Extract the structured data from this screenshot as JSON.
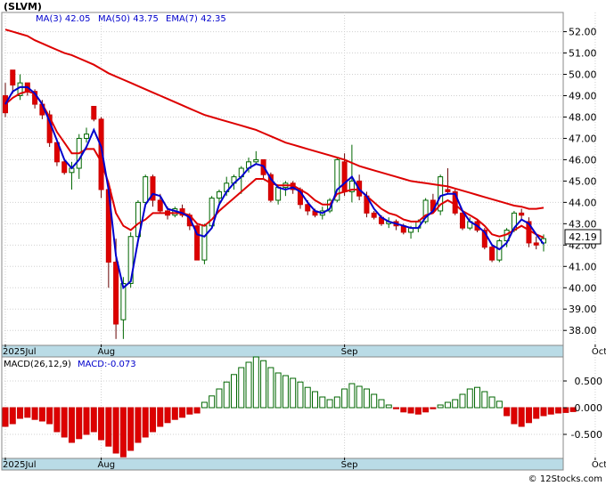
{
  "chart_data": {
    "type": "candlestick",
    "ticker_label": "(SLVM)",
    "legend": [
      {
        "label": "MA(3)",
        "value": "42.05",
        "color": "#0000cc"
      },
      {
        "label": "MA(50)",
        "value": "43.75",
        "color": "#0000cc"
      },
      {
        "label": "EMA(7)",
        "value": "42.35",
        "color": "#0000cc"
      }
    ],
    "last_price_label": "42.19",
    "x_axis_labels": [
      {
        "text": "2025Jul",
        "index": 0
      },
      {
        "text": "Aug",
        "index": 13
      },
      {
        "text": "Sep",
        "index": 46
      },
      {
        "text": "Oct",
        "index": 80
      }
    ],
    "price_axis": {
      "ylim": [
        37.3,
        52.9
      ],
      "ticks": [
        "38.00",
        "39.00",
        "40.00",
        "41.00",
        "42.00",
        "43.00",
        "44.00",
        "45.00",
        "46.00",
        "47.00",
        "48.00",
        "49.00",
        "50.00",
        "51.00",
        "52.00"
      ]
    },
    "candles": [
      [
        49.0,
        49.6,
        48.0,
        48.2
      ],
      [
        50.2,
        50.0,
        49.1,
        49.5
      ],
      [
        49.0,
        50.0,
        48.8,
        49.6
      ],
      [
        49.6,
        49.6,
        49.0,
        49.2
      ],
      [
        49.2,
        49.3,
        48.4,
        48.6
      ],
      [
        48.6,
        48.8,
        47.9,
        48.1
      ],
      [
        48.1,
        48.3,
        46.6,
        46.8
      ],
      [
        46.8,
        47.0,
        45.7,
        45.9
      ],
      [
        45.9,
        46.0,
        45.3,
        45.4
      ],
      [
        45.4,
        45.9,
        44.6,
        45.6
      ],
      [
        45.6,
        47.2,
        45.1,
        47.0
      ],
      [
        47.0,
        47.5,
        46.8,
        47.2
      ],
      [
        48.5,
        48.5,
        47.8,
        47.9
      ],
      [
        47.9,
        48.0,
        44.2,
        44.6
      ],
      [
        44.6,
        44.8,
        40.0,
        41.2
      ],
      [
        41.2,
        42.3,
        37.6,
        38.3
      ],
      [
        38.5,
        40.5,
        37.6,
        40.2
      ],
      [
        40.2,
        42.6,
        40.0,
        42.4
      ],
      [
        42.4,
        44.1,
        42.1,
        44.0
      ],
      [
        44.0,
        45.3,
        43.9,
        45.2
      ],
      [
        45.2,
        45.3,
        43.8,
        44.1
      ],
      [
        44.1,
        44.4,
        43.5,
        43.6
      ],
      [
        43.6,
        43.8,
        43.2,
        43.4
      ],
      [
        43.4,
        43.8,
        43.3,
        43.7
      ],
      [
        43.7,
        43.9,
        43.3,
        43.4
      ],
      [
        43.4,
        43.5,
        42.7,
        42.9
      ],
      [
        42.9,
        43.0,
        41.3,
        41.3
      ],
      [
        41.3,
        43.0,
        41.1,
        42.9
      ],
      [
        42.9,
        44.3,
        42.8,
        44.2
      ],
      [
        44.2,
        44.6,
        43.9,
        44.5
      ],
      [
        44.5,
        45.2,
        44.3,
        44.9
      ],
      [
        44.9,
        45.3,
        44.6,
        45.2
      ],
      [
        45.2,
        45.7,
        44.4,
        45.6
      ],
      [
        45.6,
        46.1,
        45.4,
        45.9
      ],
      [
        45.9,
        46.4,
        45.8,
        46.0
      ],
      [
        46.0,
        46.0,
        45.1,
        45.3
      ],
      [
        45.3,
        45.4,
        44.0,
        44.1
      ],
      [
        44.1,
        44.8,
        43.9,
        44.7
      ],
      [
        44.7,
        45.0,
        44.3,
        44.9
      ],
      [
        44.9,
        45.0,
        44.4,
        44.6
      ],
      [
        44.6,
        44.7,
        43.7,
        43.9
      ],
      [
        43.9,
        44.1,
        43.4,
        43.6
      ],
      [
        43.6,
        43.7,
        43.3,
        43.4
      ],
      [
        43.4,
        43.8,
        43.2,
        43.6
      ],
      [
        43.6,
        44.2,
        43.5,
        44.1
      ],
      [
        44.1,
        46.1,
        44.0,
        46.0
      ],
      [
        45.9,
        46.3,
        44.3,
        44.5
      ],
      [
        44.5,
        46.7,
        44.0,
        45.0
      ],
      [
        45.0,
        45.3,
        44.1,
        44.3
      ],
      [
        44.3,
        44.5,
        43.3,
        43.5
      ],
      [
        43.5,
        43.6,
        43.2,
        43.3
      ],
      [
        43.3,
        43.4,
        42.9,
        43.0
      ],
      [
        43.0,
        43.3,
        42.8,
        43.1
      ],
      [
        43.1,
        43.2,
        42.7,
        42.9
      ],
      [
        42.9,
        43.0,
        42.5,
        42.6
      ],
      [
        42.6,
        42.9,
        42.3,
        42.8
      ],
      [
        42.8,
        43.2,
        42.6,
        43.1
      ],
      [
        43.1,
        44.2,
        43.0,
        44.1
      ],
      [
        44.1,
        44.4,
        43.5,
        43.6
      ],
      [
        43.6,
        45.3,
        43.4,
        45.2
      ],
      [
        44.6,
        45.6,
        44.4,
        44.5
      ],
      [
        44.5,
        44.6,
        43.4,
        43.5
      ],
      [
        43.5,
        43.6,
        42.7,
        42.8
      ],
      [
        42.8,
        43.3,
        42.7,
        43.1
      ],
      [
        43.1,
        43.2,
        42.6,
        42.7
      ],
      [
        42.7,
        42.8,
        41.8,
        41.9
      ],
      [
        41.9,
        42.0,
        41.2,
        41.3
      ],
      [
        41.3,
        42.3,
        41.2,
        42.2
      ],
      [
        42.2,
        42.8,
        41.9,
        42.7
      ],
      [
        42.7,
        43.6,
        42.6,
        43.5
      ],
      [
        43.5,
        43.7,
        43.2,
        43.4
      ],
      [
        43.1,
        43.3,
        41.9,
        42.1
      ],
      [
        42.1,
        42.4,
        41.8,
        42.0
      ],
      [
        42.1,
        42.5,
        41.7,
        42.3
      ]
    ],
    "ema7": [
      48.6,
      48.9,
      49.1,
      49.2,
      49.1,
      48.6,
      48.0,
      47.3,
      46.8,
      46.3,
      46.3,
      46.5,
      46.5,
      45.9,
      44.9,
      43.5,
      42.9,
      42.7,
      43.0,
      43.2,
      43.5,
      43.5,
      43.5,
      43.5,
      43.5,
      43.4,
      43.0,
      42.9,
      43.2,
      43.6,
      43.9,
      44.2,
      44.5,
      44.8,
      45.1,
      45.1,
      44.9,
      44.8,
      44.8,
      44.8,
      44.6,
      44.4,
      44.1,
      43.9,
      43.9,
      44.4,
      44.5,
      44.6,
      44.6,
      44.3,
      44.0,
      43.7,
      43.5,
      43.4,
      43.2,
      43.1,
      43.1,
      43.4,
      43.5,
      43.9,
      44.1,
      43.9,
      43.6,
      43.4,
      43.2,
      42.9,
      42.5,
      42.4,
      42.5,
      42.7,
      42.9,
      42.7,
      42.5,
      42.35
    ],
    "ma3": [
      48.6,
      49.2,
      49.4,
      49.4,
      49.1,
      48.6,
      47.8,
      46.9,
      46.0,
      45.6,
      46.0,
      46.6,
      47.4,
      46.6,
      44.6,
      41.5,
      40.0,
      40.3,
      42.2,
      43.9,
      44.4,
      44.3,
      43.7,
      43.6,
      43.5,
      43.3,
      42.5,
      42.4,
      42.8,
      43.9,
      44.5,
      44.9,
      45.2,
      45.6,
      45.8,
      45.7,
      45.1,
      44.7,
      44.6,
      44.7,
      44.5,
      44.0,
      43.6,
      43.5,
      43.7,
      44.6,
      44.9,
      45.2,
      44.6,
      44.3,
      43.7,
      43.3,
      43.1,
      43.0,
      42.9,
      42.8,
      42.8,
      43.3,
      43.6,
      44.3,
      44.4,
      44.4,
      43.6,
      43.1,
      42.9,
      42.6,
      42.0,
      41.8,
      42.1,
      42.8,
      43.2,
      43.0,
      42.5,
      42.05
    ],
    "ma50": [
      52.1,
      52.0,
      51.9,
      51.8,
      51.6,
      51.45,
      51.3,
      51.15,
      51.0,
      50.9,
      50.75,
      50.6,
      50.45,
      50.25,
      50.05,
      49.9,
      49.75,
      49.6,
      49.45,
      49.3,
      49.15,
      49.0,
      48.85,
      48.7,
      48.55,
      48.4,
      48.25,
      48.1,
      48.0,
      47.9,
      47.8,
      47.7,
      47.6,
      47.5,
      47.4,
      47.25,
      47.1,
      46.95,
      46.8,
      46.7,
      46.6,
      46.5,
      46.4,
      46.3,
      46.2,
      46.1,
      46.0,
      45.85,
      45.7,
      45.6,
      45.5,
      45.4,
      45.3,
      45.2,
      45.1,
      45.0,
      44.95,
      44.9,
      44.85,
      44.8,
      44.75,
      44.65,
      44.55,
      44.45,
      44.35,
      44.25,
      44.15,
      44.05,
      43.95,
      43.85,
      43.8,
      43.7,
      43.7,
      43.75
    ],
    "macd_panel": {
      "label": "MACD(26,12,9)",
      "value_label": "MACD:-0.073",
      "ylim": [
        -0.95,
        0.95
      ],
      "ticks": [
        "0.500",
        "0.000",
        "-0.500"
      ],
      "values": [
        -0.35,
        -0.3,
        -0.2,
        -0.18,
        -0.22,
        -0.25,
        -0.3,
        -0.45,
        -0.55,
        -0.65,
        -0.58,
        -0.5,
        -0.45,
        -0.6,
        -0.72,
        -0.85,
        -0.92,
        -0.8,
        -0.65,
        -0.55,
        -0.45,
        -0.35,
        -0.28,
        -0.22,
        -0.18,
        -0.12,
        -0.1,
        0.1,
        0.22,
        0.35,
        0.48,
        0.62,
        0.75,
        0.85,
        0.95,
        0.88,
        0.75,
        0.65,
        0.6,
        0.55,
        0.48,
        0.38,
        0.3,
        0.2,
        0.15,
        0.2,
        0.35,
        0.45,
        0.4,
        0.35,
        0.25,
        0.15,
        0.05,
        -0.02,
        -0.08,
        -0.1,
        -0.12,
        -0.08,
        -0.02,
        0.05,
        0.1,
        0.15,
        0.25,
        0.35,
        0.38,
        0.3,
        0.2,
        0.12,
        -0.15,
        -0.3,
        -0.35,
        -0.28,
        -0.2,
        -0.15,
        -0.12,
        -0.1,
        -0.09,
        -0.073
      ]
    },
    "watermark": "© 12Stocks.com"
  }
}
